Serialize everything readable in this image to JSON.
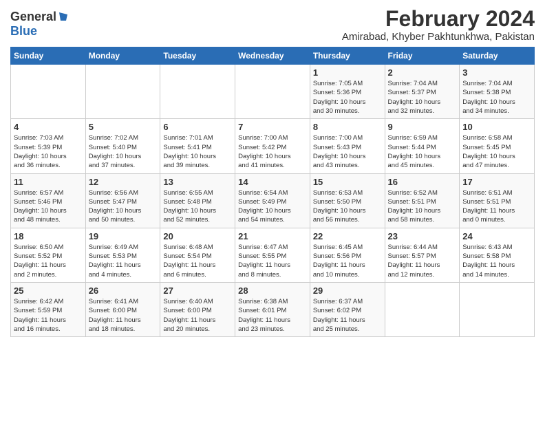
{
  "logo": {
    "general": "General",
    "blue": "Blue"
  },
  "title": "February 2024",
  "subtitle": "Amirabad, Khyber Pakhtunkhwa, Pakistan",
  "weekdays": [
    "Sunday",
    "Monday",
    "Tuesday",
    "Wednesday",
    "Thursday",
    "Friday",
    "Saturday"
  ],
  "weeks": [
    [
      {
        "day": "",
        "info": ""
      },
      {
        "day": "",
        "info": ""
      },
      {
        "day": "",
        "info": ""
      },
      {
        "day": "",
        "info": ""
      },
      {
        "day": "1",
        "info": "Sunrise: 7:05 AM\nSunset: 5:36 PM\nDaylight: 10 hours\nand 30 minutes."
      },
      {
        "day": "2",
        "info": "Sunrise: 7:04 AM\nSunset: 5:37 PM\nDaylight: 10 hours\nand 32 minutes."
      },
      {
        "day": "3",
        "info": "Sunrise: 7:04 AM\nSunset: 5:38 PM\nDaylight: 10 hours\nand 34 minutes."
      }
    ],
    [
      {
        "day": "4",
        "info": "Sunrise: 7:03 AM\nSunset: 5:39 PM\nDaylight: 10 hours\nand 36 minutes."
      },
      {
        "day": "5",
        "info": "Sunrise: 7:02 AM\nSunset: 5:40 PM\nDaylight: 10 hours\nand 37 minutes."
      },
      {
        "day": "6",
        "info": "Sunrise: 7:01 AM\nSunset: 5:41 PM\nDaylight: 10 hours\nand 39 minutes."
      },
      {
        "day": "7",
        "info": "Sunrise: 7:00 AM\nSunset: 5:42 PM\nDaylight: 10 hours\nand 41 minutes."
      },
      {
        "day": "8",
        "info": "Sunrise: 7:00 AM\nSunset: 5:43 PM\nDaylight: 10 hours\nand 43 minutes."
      },
      {
        "day": "9",
        "info": "Sunrise: 6:59 AM\nSunset: 5:44 PM\nDaylight: 10 hours\nand 45 minutes."
      },
      {
        "day": "10",
        "info": "Sunrise: 6:58 AM\nSunset: 5:45 PM\nDaylight: 10 hours\nand 47 minutes."
      }
    ],
    [
      {
        "day": "11",
        "info": "Sunrise: 6:57 AM\nSunset: 5:46 PM\nDaylight: 10 hours\nand 48 minutes."
      },
      {
        "day": "12",
        "info": "Sunrise: 6:56 AM\nSunset: 5:47 PM\nDaylight: 10 hours\nand 50 minutes."
      },
      {
        "day": "13",
        "info": "Sunrise: 6:55 AM\nSunset: 5:48 PM\nDaylight: 10 hours\nand 52 minutes."
      },
      {
        "day": "14",
        "info": "Sunrise: 6:54 AM\nSunset: 5:49 PM\nDaylight: 10 hours\nand 54 minutes."
      },
      {
        "day": "15",
        "info": "Sunrise: 6:53 AM\nSunset: 5:50 PM\nDaylight: 10 hours\nand 56 minutes."
      },
      {
        "day": "16",
        "info": "Sunrise: 6:52 AM\nSunset: 5:51 PM\nDaylight: 10 hours\nand 58 minutes."
      },
      {
        "day": "17",
        "info": "Sunrise: 6:51 AM\nSunset: 5:51 PM\nDaylight: 11 hours\nand 0 minutes."
      }
    ],
    [
      {
        "day": "18",
        "info": "Sunrise: 6:50 AM\nSunset: 5:52 PM\nDaylight: 11 hours\nand 2 minutes."
      },
      {
        "day": "19",
        "info": "Sunrise: 6:49 AM\nSunset: 5:53 PM\nDaylight: 11 hours\nand 4 minutes."
      },
      {
        "day": "20",
        "info": "Sunrise: 6:48 AM\nSunset: 5:54 PM\nDaylight: 11 hours\nand 6 minutes."
      },
      {
        "day": "21",
        "info": "Sunrise: 6:47 AM\nSunset: 5:55 PM\nDaylight: 11 hours\nand 8 minutes."
      },
      {
        "day": "22",
        "info": "Sunrise: 6:45 AM\nSunset: 5:56 PM\nDaylight: 11 hours\nand 10 minutes."
      },
      {
        "day": "23",
        "info": "Sunrise: 6:44 AM\nSunset: 5:57 PM\nDaylight: 11 hours\nand 12 minutes."
      },
      {
        "day": "24",
        "info": "Sunrise: 6:43 AM\nSunset: 5:58 PM\nDaylight: 11 hours\nand 14 minutes."
      }
    ],
    [
      {
        "day": "25",
        "info": "Sunrise: 6:42 AM\nSunset: 5:59 PM\nDaylight: 11 hours\nand 16 minutes."
      },
      {
        "day": "26",
        "info": "Sunrise: 6:41 AM\nSunset: 6:00 PM\nDaylight: 11 hours\nand 18 minutes."
      },
      {
        "day": "27",
        "info": "Sunrise: 6:40 AM\nSunset: 6:00 PM\nDaylight: 11 hours\nand 20 minutes."
      },
      {
        "day": "28",
        "info": "Sunrise: 6:38 AM\nSunset: 6:01 PM\nDaylight: 11 hours\nand 23 minutes."
      },
      {
        "day": "29",
        "info": "Sunrise: 6:37 AM\nSunset: 6:02 PM\nDaylight: 11 hours\nand 25 minutes."
      },
      {
        "day": "",
        "info": ""
      },
      {
        "day": "",
        "info": ""
      }
    ]
  ]
}
